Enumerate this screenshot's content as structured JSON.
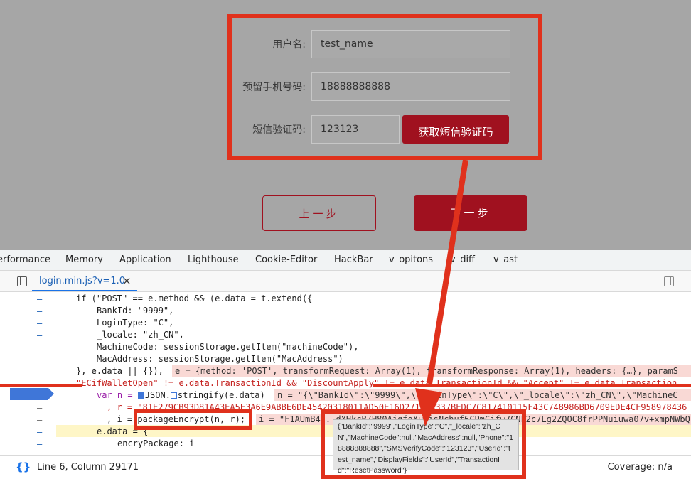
{
  "form": {
    "username_label": "用户名:",
    "username_value": "test_name",
    "phone_label": "预留手机号码:",
    "phone_value": "18888888888",
    "sms_label": "短信验证码:",
    "sms_value": "123123",
    "sms_button": "获取短信验证码",
    "prev_button": "上一步",
    "next_button": "下一步"
  },
  "devtools": {
    "tabs": [
      "erformance",
      "Memory",
      "Application",
      "Lighthouse",
      "Cookie-Editor",
      "HackBar",
      "v_opitons",
      "v_diff",
      "v_ast"
    ],
    "file_tab": "login.min.js?v=1.0",
    "close_glyph": "×",
    "status_position": "Line 6, Column 29171",
    "status_coverage": "Coverage: n/a",
    "braces_glyph": "{}",
    "code": {
      "l1": "if (\"POST\" == e.method && (e.data = t.extend({",
      "l2": "BankId: \"9999\",",
      "l3": "LoginType: \"C\",",
      "l4": "_locale: \"zh_CN\",",
      "l5": "MachineCode: sessionStorage.getItem(\"machineCode\"),",
      "l6": "MacAddress: sessionStorage.getItem(\"MacAddress\")",
      "l7": "}, e.data || {}),",
      "l7_inline": "e = {method: 'POST', transformRequest: Array(1), transformResponse: Array(1), headers: {…}, paramS",
      "l8": "\"ECifWalletOpen\" != e.data.TransactionId && \"DiscountApply\" != e.data.TransactionId && \"Accept\" != e.data.Transaction",
      "l9_a": "var n = ",
      "l9_b": "JSON.",
      "l9_c": "stringify(e.data)",
      "l9_inline": "n = \"{\\\"BankId\\\":\\\"9999\\\",\\\"LoginType\\\":\\\"C\\\",\\\"_locale\\\":\\\"zh_CN\\\",\\\"MachineC",
      "l10": ", r = \"81E279CB93D81A43EA5E3A6E9ABBE6DE45420318011AD50E16D27103A337BEDC7C817410115F43C748986BD6709EDE4CF958978436",
      "l11_a": ", i = ",
      "l11_b": "packageEncrypt(n, r);",
      "l11_inline": "i = \"F1AUmB4...dXHkcB/H80AjgfoXuuisNchuf6CPmCjfw7CNF2c7Lg2ZQOC8frPPNuiuwa07v+xmpNWbQ",
      "l12": "e.data = {",
      "l13": "encryPackage: i"
    },
    "tooltip": "{\"BankId\":\"9999\",\"LoginType\":\"C\",\"_locale\":\"zh_CN\",\"MachineCode\":null,\"MacAddress\":null,\"Phone\":\"18888888888\",\"SMSVerifyCode\":\"123123\",\"UserId\":\"test_name\",\"DisplayFields\":\"UserId\",\"TransactionId\":\"ResetPassword\"}"
  },
  "colors": {
    "brand_red": "#a0111f",
    "annotation_red": "#e0311c",
    "breakpoint_blue": "#3f76d8"
  },
  "icons": [
    "sidebar-toggle-icon",
    "close-icon",
    "right-panel-icon",
    "braces-icon",
    "arrow-annotation"
  ]
}
